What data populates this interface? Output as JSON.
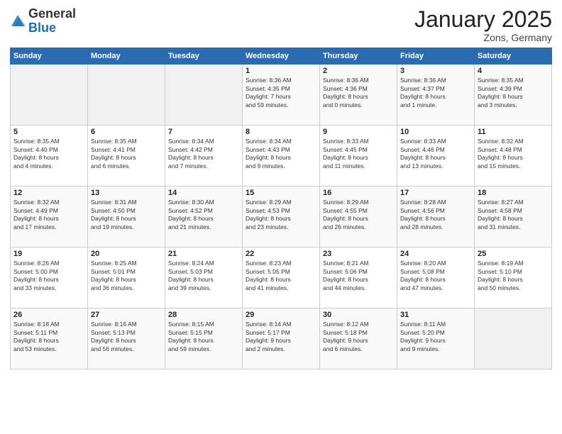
{
  "logo": {
    "general": "General",
    "blue": "Blue"
  },
  "header": {
    "title": "January 2025",
    "subtitle": "Zons, Germany"
  },
  "days_of_week": [
    "Sunday",
    "Monday",
    "Tuesday",
    "Wednesday",
    "Thursday",
    "Friday",
    "Saturday"
  ],
  "weeks": [
    [
      {
        "day": "",
        "info": ""
      },
      {
        "day": "",
        "info": ""
      },
      {
        "day": "",
        "info": ""
      },
      {
        "day": "1",
        "info": "Sunrise: 8:36 AM\nSunset: 4:35 PM\nDaylight: 7 hours\nand 59 minutes."
      },
      {
        "day": "2",
        "info": "Sunrise: 8:36 AM\nSunset: 4:36 PM\nDaylight: 8 hours\nand 0 minutes."
      },
      {
        "day": "3",
        "info": "Sunrise: 8:36 AM\nSunset: 4:37 PM\nDaylight: 8 hours\nand 1 minute."
      },
      {
        "day": "4",
        "info": "Sunrise: 8:35 AM\nSunset: 4:39 PM\nDaylight: 8 hours\nand 3 minutes."
      }
    ],
    [
      {
        "day": "5",
        "info": "Sunrise: 8:35 AM\nSunset: 4:40 PM\nDaylight: 8 hours\nand 4 minutes."
      },
      {
        "day": "6",
        "info": "Sunrise: 8:35 AM\nSunset: 4:41 PM\nDaylight: 8 hours\nand 6 minutes."
      },
      {
        "day": "7",
        "info": "Sunrise: 8:34 AM\nSunset: 4:42 PM\nDaylight: 8 hours\nand 7 minutes."
      },
      {
        "day": "8",
        "info": "Sunrise: 8:34 AM\nSunset: 4:43 PM\nDaylight: 8 hours\nand 9 minutes."
      },
      {
        "day": "9",
        "info": "Sunrise: 8:33 AM\nSunset: 4:45 PM\nDaylight: 8 hours\nand 11 minutes."
      },
      {
        "day": "10",
        "info": "Sunrise: 8:33 AM\nSunset: 4:46 PM\nDaylight: 8 hours\nand 13 minutes."
      },
      {
        "day": "11",
        "info": "Sunrise: 8:32 AM\nSunset: 4:48 PM\nDaylight: 8 hours\nand 15 minutes."
      }
    ],
    [
      {
        "day": "12",
        "info": "Sunrise: 8:32 AM\nSunset: 4:49 PM\nDaylight: 8 hours\nand 17 minutes."
      },
      {
        "day": "13",
        "info": "Sunrise: 8:31 AM\nSunset: 4:50 PM\nDaylight: 8 hours\nand 19 minutes."
      },
      {
        "day": "14",
        "info": "Sunrise: 8:30 AM\nSunset: 4:52 PM\nDaylight: 8 hours\nand 21 minutes."
      },
      {
        "day": "15",
        "info": "Sunrise: 8:29 AM\nSunset: 4:53 PM\nDaylight: 8 hours\nand 23 minutes."
      },
      {
        "day": "16",
        "info": "Sunrise: 8:29 AM\nSunset: 4:55 PM\nDaylight: 8 hours\nand 26 minutes."
      },
      {
        "day": "17",
        "info": "Sunrise: 8:28 AM\nSunset: 4:56 PM\nDaylight: 8 hours\nand 28 minutes."
      },
      {
        "day": "18",
        "info": "Sunrise: 8:27 AM\nSunset: 4:58 PM\nDaylight: 8 hours\nand 31 minutes."
      }
    ],
    [
      {
        "day": "19",
        "info": "Sunrise: 8:26 AM\nSunset: 5:00 PM\nDaylight: 8 hours\nand 33 minutes."
      },
      {
        "day": "20",
        "info": "Sunrise: 8:25 AM\nSunset: 5:01 PM\nDaylight: 8 hours\nand 36 minutes."
      },
      {
        "day": "21",
        "info": "Sunrise: 8:24 AM\nSunset: 5:03 PM\nDaylight: 8 hours\nand 39 minutes."
      },
      {
        "day": "22",
        "info": "Sunrise: 8:23 AM\nSunset: 5:05 PM\nDaylight: 8 hours\nand 41 minutes."
      },
      {
        "day": "23",
        "info": "Sunrise: 8:21 AM\nSunset: 5:06 PM\nDaylight: 8 hours\nand 44 minutes."
      },
      {
        "day": "24",
        "info": "Sunrise: 8:20 AM\nSunset: 5:08 PM\nDaylight: 8 hours\nand 47 minutes."
      },
      {
        "day": "25",
        "info": "Sunrise: 8:19 AM\nSunset: 5:10 PM\nDaylight: 8 hours\nand 50 minutes."
      }
    ],
    [
      {
        "day": "26",
        "info": "Sunrise: 8:18 AM\nSunset: 5:11 PM\nDaylight: 8 hours\nand 53 minutes."
      },
      {
        "day": "27",
        "info": "Sunrise: 8:16 AM\nSunset: 5:13 PM\nDaylight: 8 hours\nand 56 minutes."
      },
      {
        "day": "28",
        "info": "Sunrise: 8:15 AM\nSunset: 5:15 PM\nDaylight: 8 hours\nand 59 minutes."
      },
      {
        "day": "29",
        "info": "Sunrise: 8:14 AM\nSunset: 5:17 PM\nDaylight: 9 hours\nand 2 minutes."
      },
      {
        "day": "30",
        "info": "Sunrise: 8:12 AM\nSunset: 5:18 PM\nDaylight: 9 hours\nand 6 minutes."
      },
      {
        "day": "31",
        "info": "Sunrise: 8:11 AM\nSunset: 5:20 PM\nDaylight: 9 hours\nand 9 minutes."
      },
      {
        "day": "",
        "info": ""
      }
    ]
  ]
}
